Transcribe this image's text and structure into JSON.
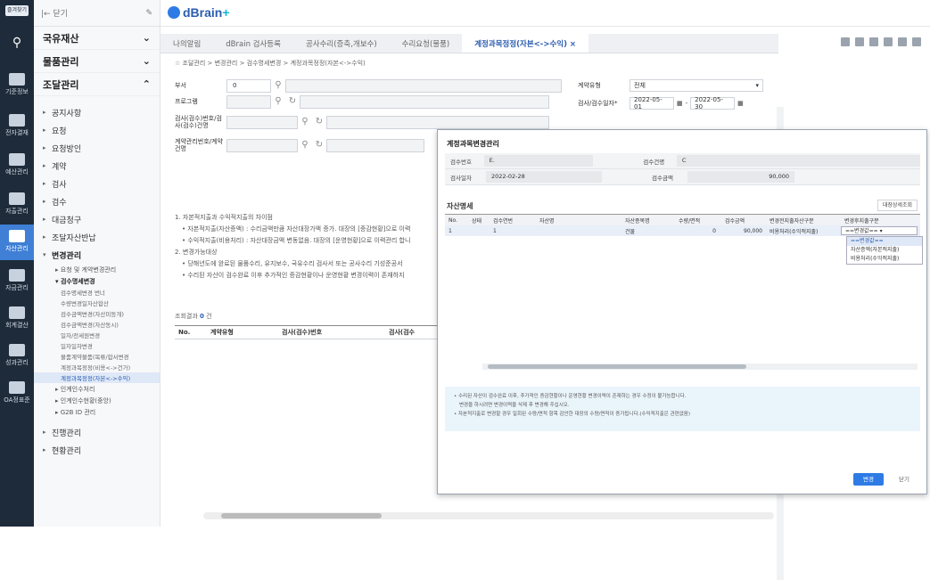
{
  "rail": {
    "top_label": "즐겨찾기",
    "items": [
      {
        "label": "기준정보",
        "icon": "home-icon"
      },
      {
        "label": "전자결재",
        "icon": "send-icon"
      },
      {
        "label": "예산관리",
        "icon": "coins-icon"
      },
      {
        "label": "자출관리",
        "icon": "chart-icon"
      },
      {
        "label": "자산관리",
        "icon": "building-icon"
      },
      {
        "label": "자금관리",
        "icon": "globe-icon"
      },
      {
        "label": "회계결산",
        "icon": "ledger-icon"
      },
      {
        "label": "성과관리",
        "icon": "graph-icon"
      },
      {
        "label": "OA정표준",
        "icon": "doc-icon"
      }
    ]
  },
  "sidebar": {
    "back_label": "|← 닫기",
    "groups": [
      {
        "label": "국유재산",
        "chevron": "v"
      },
      {
        "label": "물품관리",
        "chevron": "v"
      },
      {
        "label": "조달관리",
        "chevron": "^"
      }
    ],
    "items": [
      "공지사항",
      "요청",
      "요청방인",
      "계약",
      "검사",
      "검수",
      "대금청구",
      "조달자산반납",
      "변경관리"
    ],
    "sub_items": [
      "요청 및 계약변경관리",
      "검수명세변경"
    ],
    "sub2_items": [
      "검수명세변경 번너",
      "수량변경일자산합산",
      "검수금액변경(자산미동개)",
      "검수금액변경(자산동시)",
      "일자/전세원변경",
      "일자일자변경",
      "물품계약물품(목류/합서변경",
      "계정과목정정(비용<->건가)",
      "계정과목정정(자본<->수익)"
    ],
    "tail_items": [
      "인계인수처리",
      "인계인수현황(중앙)",
      "G2B ID 관리",
      "진행관리",
      "현황관리"
    ]
  },
  "header": {
    "logo": "dBrain",
    "logo_sup": "+"
  },
  "tabs": [
    {
      "label": "나의알림",
      "active": false
    },
    {
      "label": "dBrain 검사등록",
      "active": false
    },
    {
      "label": "공사수리(증축,개보수)",
      "active": false
    },
    {
      "label": "수리요청(물품)",
      "active": false
    },
    {
      "label": "계정과목정정(자본<->수익) ×",
      "active": true
    }
  ],
  "breadcrumb": "조달관리 > 변경관리 > 검수명세변경 > 계정과목정정(자본<->수익)",
  "form": {
    "dept_label": "부서",
    "dept_value": "0",
    "program_label": "프로그램",
    "inspect_label": "검사(검수)번호/검사(검수)건명",
    "contract_label": "계약관리번호/계약건명",
    "type_label": "계약유형",
    "type_value": "전체",
    "date_label": "검사/검수일자*",
    "date_from": "2022-05-01",
    "date_to": "2022-05-30"
  },
  "notice_lines": [
    "1. 자본적지출과 수익적지출의 차이점",
    "• 자본적지출(자산증액) : 수리금액만큼 자산대장가액 증가. 대장의 [증감현황]으로 이력",
    "• 수익적지출(비용처리) : 자산대장금액 변동없음. 대장의 [운영현황]으로 이력관리 합니",
    "2. 변경가능대상",
    "• 당해년도에 완료된 물품수리, 유지보수, 국유수리 검사서 또는 공사수리 기성준공서",
    "• 수리된 자산이 검수완료 이후 추가적인 증감현황이나 운영현황 변경이력이 존재하지"
  ],
  "result": {
    "label": "조회결과",
    "count": "0",
    "unit": "건"
  },
  "grid_head": [
    "No.",
    "계약유형",
    "검사(검수)번호",
    "검사(검수"
  ],
  "modal": {
    "title": "계정과목변경관리",
    "inspect_no_label": "검수번호",
    "inspect_no_value": "E.",
    "inspect_name_label": "검수건명",
    "inspect_name_value": "C",
    "inspect_date_label": "검사일자",
    "inspect_date_value": "2022-02-28",
    "inspect_amount_label": "검수금액",
    "inspect_amount_value": "90,000",
    "asset_label": "자산명세",
    "asset_button": "대장상세조회",
    "grid_head": [
      "No.",
      "상태",
      "검수연번",
      "자산명",
      "자산종목명",
      "수량/면적",
      "검수금액",
      "변경전지출자산구분",
      "변경후지출구분"
    ],
    "row": [
      "1",
      "",
      "1",
      "",
      "건물",
      "0",
      "90,000",
      "비용처리(수익적지출)",
      "==변경값==  ▾"
    ],
    "dropdown": [
      "==변경값==",
      "자산증액(자본적지출)",
      "비용처리(수익적지출)"
    ],
    "notice": [
      "• 수리된 자산이 검수완료 이후, 추가적인 증감현황이나 운영현황 변경이력이 존재하는 경우 수정이 불가능합니다.",
      "변경을 하시려면 변경이력을 삭제 후 변경해 주십시오.",
      "• 자본적지출로 변경할 경우 일회된 수량/면적 항목 감안한 대장의 수량/면적이 증가됩니다.(수익적지출은 관련없음)"
    ],
    "btn_change": "변경",
    "btn_close": "닫기"
  }
}
